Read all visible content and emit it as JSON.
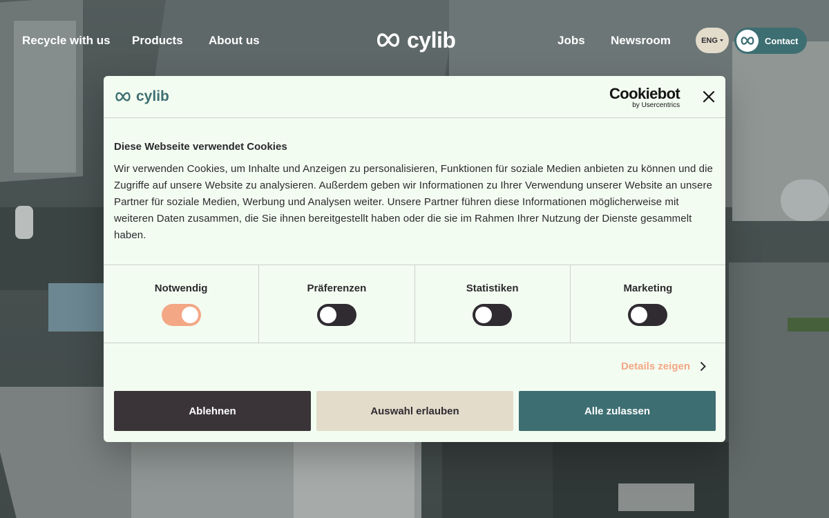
{
  "nav": {
    "left_links": [
      "Recycle with us",
      "Products",
      "About us"
    ],
    "logo_text": "cylib",
    "right_links": [
      "Jobs",
      "Newsroom"
    ],
    "language": "ENG",
    "contact_label": "Contact"
  },
  "dialog": {
    "logo_text": "cylib",
    "provider_brand": "Cookiebot",
    "provider_sub": "by Usercentrics",
    "title": "Diese Webseite verwendet Cookies",
    "text": "Wir verwenden Cookies, um Inhalte und Anzeigen zu personalisieren, Funktionen für soziale Medien anbieten zu können und die Zugriffe auf unsere Website zu analysieren. Außerdem geben wir Informationen zu Ihrer Verwendung unserer Website an unsere Partner für soziale Medien, Werbung und Analysen weiter. Unsere Partner führen diese Informationen möglicherweise mit weiteren Daten zusammen, die Sie ihnen bereitgestellt haben oder die sie im Rahmen Ihrer Nutzung der Dienste gesammelt haben.",
    "categories": [
      {
        "label": "Notwendig",
        "enabled": true
      },
      {
        "label": "Präferenzen",
        "enabled": false
      },
      {
        "label": "Statistiken",
        "enabled": false
      },
      {
        "label": "Marketing",
        "enabled": false
      }
    ],
    "details_label": "Details zeigen",
    "buttons": {
      "decline": "Ablehnen",
      "allow_selection": "Auswahl erlauben",
      "allow_all": "Alle zulassen"
    }
  },
  "colors": {
    "accent_teal": "#3d6e72",
    "accent_peach": "#f3a784",
    "dark": "#3a3439",
    "sand": "#e3dccb",
    "dialog_bg": "#f3fcf1"
  }
}
